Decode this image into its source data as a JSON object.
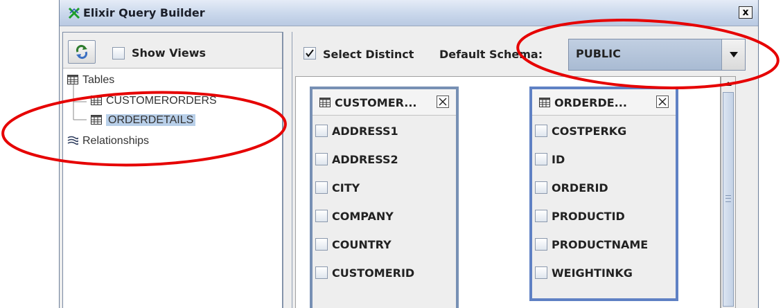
{
  "window": {
    "title": "Elixir Query Builder",
    "close_glyph": "x"
  },
  "left_panel": {
    "refresh_icon": "refresh-icon",
    "show_views_label": "Show Views",
    "show_views_checked": false,
    "tree": {
      "tables_label": "Tables",
      "items": [
        "CUSTOMERORDERS",
        "ORDERDETAILS"
      ],
      "selected_item": "ORDERDETAILS",
      "relationships_label": "Relationships"
    }
  },
  "toolbar": {
    "select_distinct_label": "Select Distinct",
    "select_distinct_checked": true,
    "default_schema_label": "Default Schema:",
    "default_schema_value": "PUBLIC"
  },
  "tables": [
    {
      "title": "CUSTOMER...",
      "fields": [
        "ADDRESS1",
        "ADDRESS2",
        "CITY",
        "COMPANY",
        "COUNTRY",
        "CUSTOMERID"
      ]
    },
    {
      "title": "ORDERDE...",
      "fields": [
        "COSTPERKG",
        "ID",
        "ORDERID",
        "PRODUCTID",
        "PRODUCTNAME",
        "WEIGHTINKG"
      ]
    }
  ],
  "colors": {
    "annotation": "#e60000",
    "selection": "#b8cfe9",
    "table_border": "#7790b4"
  }
}
